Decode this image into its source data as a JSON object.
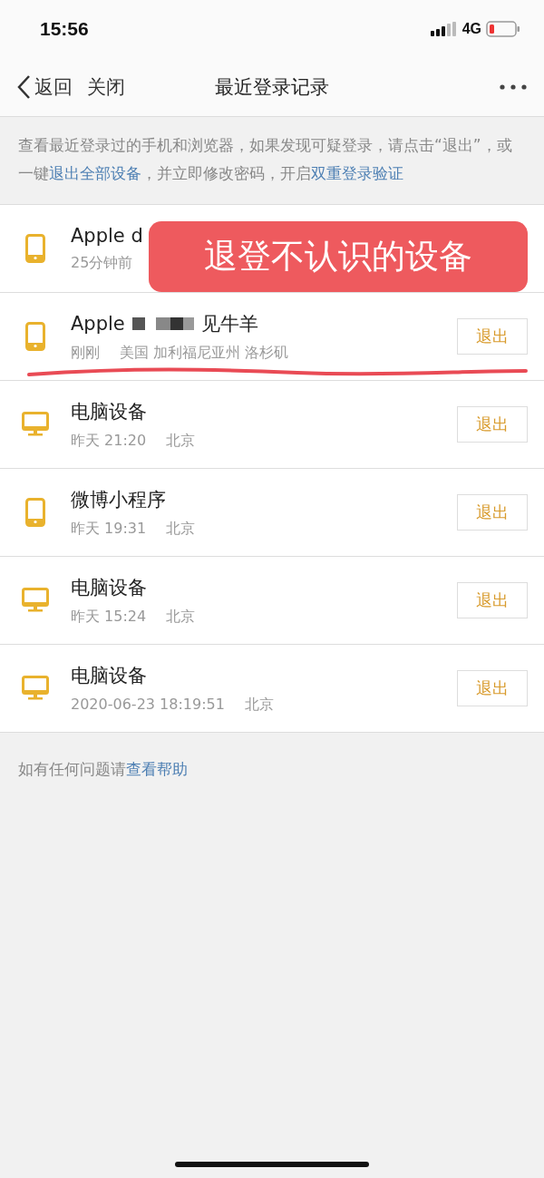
{
  "status_bar": {
    "time": "15:56",
    "network": "4G"
  },
  "nav": {
    "back": "返回",
    "close": "关闭",
    "title": "最近登录记录"
  },
  "notice": [
    {
      "text": "查看最近登录过的手机和浏览器，如果发现可疑登录，请点击“退出”，或一键",
      "link": false
    },
    {
      "text": "退出全部设备",
      "link": true
    },
    {
      "text": "，并立即修改密码，开启",
      "link": false
    },
    {
      "text": "双重登录验证",
      "link": true
    }
  ],
  "devices": [
    {
      "kind": "phone",
      "name": "Apple d",
      "time": "25分钟前"
    },
    {
      "kind": "phone",
      "name": "Apple",
      "redacted": true,
      "name_end": "见牛羊",
      "time": "刚刚",
      "location": "美国 加利福尼亚州 洛杉矶",
      "button": "退出",
      "underlined": true
    },
    {
      "kind": "computer",
      "name": "电脑设备",
      "time": "昨天 21:20",
      "location": "北京",
      "button": "退出"
    },
    {
      "kind": "phone",
      "name": "微博小程序",
      "time": "昨天 19:31",
      "location": "北京",
      "button": "退出"
    },
    {
      "kind": "computer",
      "name": "电脑设备",
      "time": "昨天 15:24",
      "location": "北京",
      "button": "退出"
    },
    {
      "kind": "computer",
      "name": "电脑设备",
      "time": "2020-06-23 18:19:51",
      "location": "北京",
      "button": "退出"
    }
  ],
  "banner": "退登不认识的设备",
  "footer": {
    "text": "如有任何问题请",
    "link": "查看帮助"
  }
}
